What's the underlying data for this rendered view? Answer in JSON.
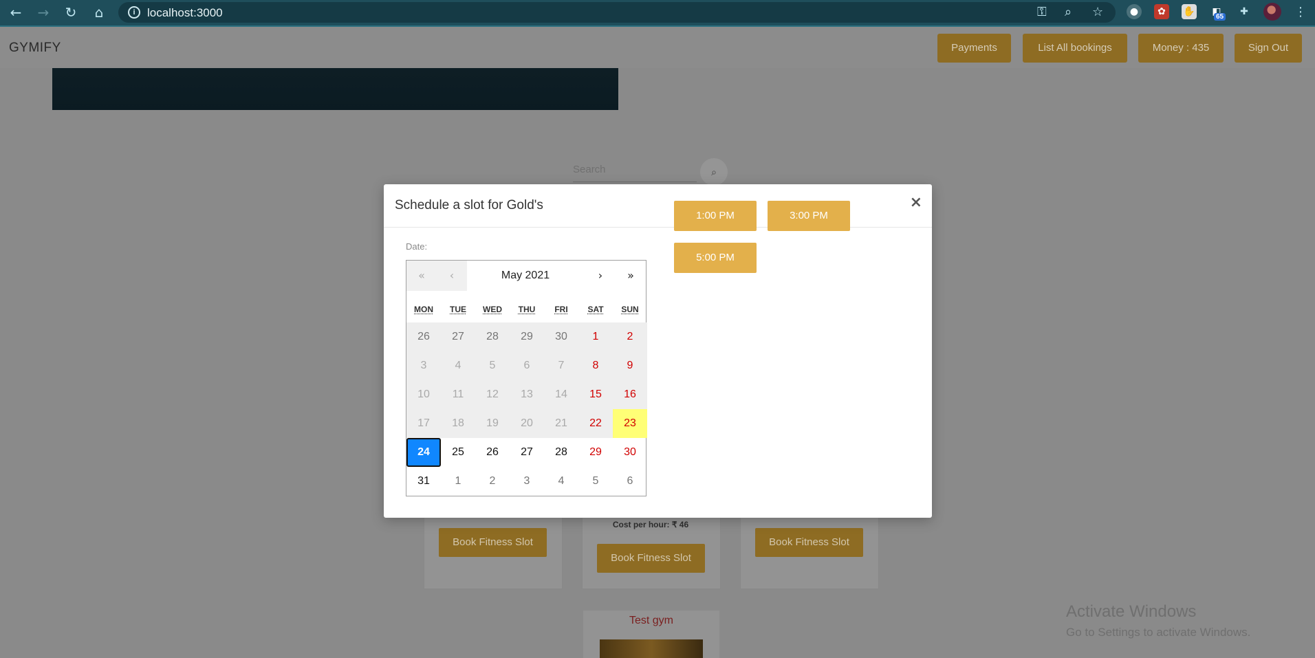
{
  "browser": {
    "url": "localhost:3000",
    "extension_badge": "65"
  },
  "header": {
    "brand": "GYMIFY",
    "nav": [
      "Payments",
      "List All bookings",
      "Money : 435",
      "Sign Out"
    ]
  },
  "page": {
    "search_placeholder": "Search",
    "cost_text": "Cost per hour: ₹ 46",
    "book_button_label": "Book Fitness Slot",
    "test_gym_title": "Test gym"
  },
  "windows_notice": {
    "title": "Activate Windows",
    "subtitle": "Go to Settings to activate Windows."
  },
  "modal": {
    "title": "Schedule a slot for Gold's",
    "close": "×",
    "date_label": "Date:",
    "calendar": {
      "month_label": "May 2021",
      "nav": {
        "prev_year": "«",
        "prev_month": "‹",
        "next_month": "›",
        "next_year": "»"
      },
      "weekdays": [
        "MON",
        "TUE",
        "WED",
        "THU",
        "FRI",
        "SAT",
        "SUN"
      ],
      "weeks": [
        [
          "26",
          "27",
          "28",
          "29",
          "30",
          "1",
          "2"
        ],
        [
          "3",
          "4",
          "5",
          "6",
          "7",
          "8",
          "9"
        ],
        [
          "10",
          "11",
          "12",
          "13",
          "14",
          "15",
          "16"
        ],
        [
          "17",
          "18",
          "19",
          "20",
          "21",
          "22",
          "23"
        ],
        [
          "24",
          "25",
          "26",
          "27",
          "28",
          "29",
          "30"
        ],
        [
          "31",
          "1",
          "2",
          "3",
          "4",
          "5",
          "6"
        ]
      ],
      "selected": "24",
      "today": "23"
    },
    "slots": [
      "1:00 PM",
      "3:00 PM",
      "5:00 PM"
    ]
  },
  "colors": {
    "slot": "#e3b04b",
    "selected_day": "#1087ff",
    "today": "#ffff76",
    "weekend": "#d10000"
  }
}
